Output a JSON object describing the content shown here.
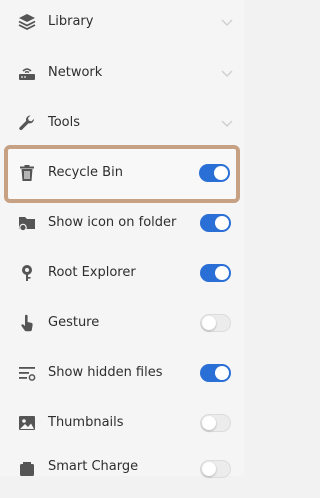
{
  "menu": {
    "library_label": "Library",
    "network_label": "Network",
    "tools_label": "Tools"
  },
  "tools": {
    "recycle_bin": {
      "label": "Recycle Bin",
      "enabled": true
    },
    "show_icon_on_folder": {
      "label": "Show icon on folder",
      "enabled": true
    },
    "root_explorer": {
      "label": "Root Explorer",
      "enabled": true
    },
    "gesture": {
      "label": "Gesture",
      "enabled": false
    },
    "show_hidden_files": {
      "label": "Show hidden files",
      "enabled": true
    },
    "thumbnails": {
      "label": "Thumbnails",
      "enabled": false
    },
    "smart_charge": {
      "label": "Smart Charge",
      "enabled": false
    }
  },
  "colors": {
    "toggle_on": "#2a6fd6",
    "toggle_off": "#ececec",
    "icon": "#555555",
    "highlight_border": "#c6a184"
  },
  "icons": {
    "library": "layers-icon",
    "network": "router-icon",
    "tools": "wrench-icon",
    "recycle_bin": "trash-icon",
    "show_icon_on_folder": "folder-icon",
    "root_explorer": "root-key-icon",
    "gesture": "hand-pointer-icon",
    "show_hidden_files": "hidden-files-icon",
    "thumbnails": "image-icon",
    "smart_charge": "battery-icon"
  }
}
